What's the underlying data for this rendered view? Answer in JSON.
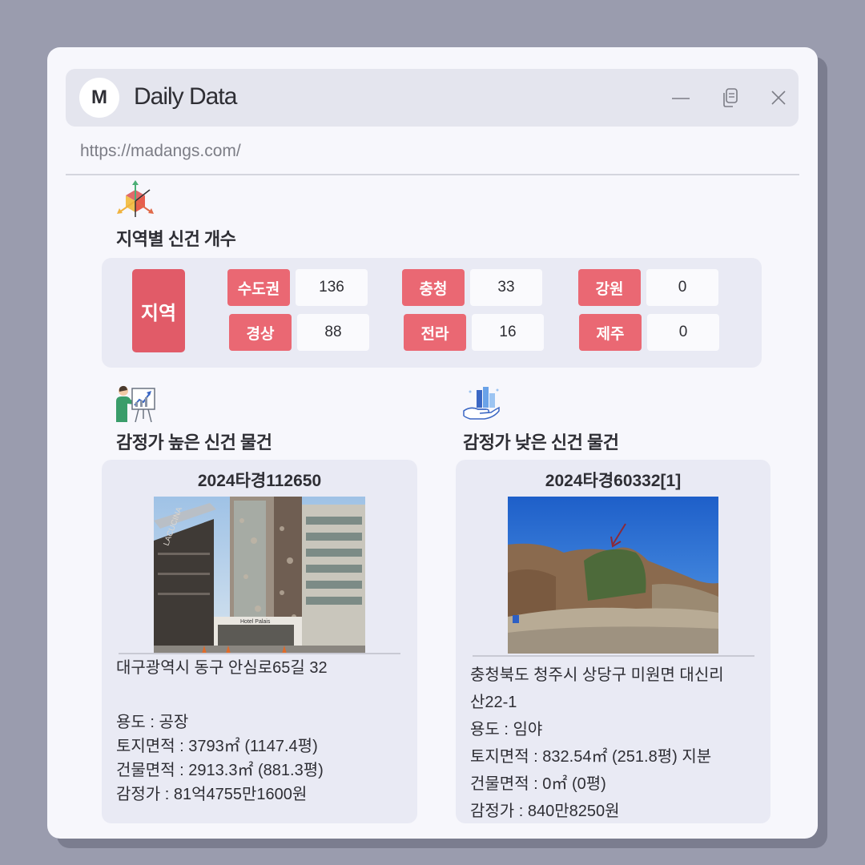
{
  "app": {
    "logo_letter": "M",
    "title": "Daily Data",
    "url": "https://madangs.com/"
  },
  "icons": {
    "minimize": "minimize-icon",
    "copy": "copy-icon",
    "close": "close-icon",
    "region_section": "3d-axis-cube-icon",
    "high_section": "presenter-chart-icon",
    "low_section": "hand-bar-chart-icon"
  },
  "regions": {
    "title": "지역별 신건 개수",
    "header": "지역",
    "items": [
      {
        "name": "수도권",
        "count": "136"
      },
      {
        "name": "충청",
        "count": "33"
      },
      {
        "name": "강원",
        "count": "0"
      },
      {
        "name": "경상",
        "count": "88"
      },
      {
        "name": "전라",
        "count": "16"
      },
      {
        "name": "제주",
        "count": "0"
      }
    ]
  },
  "high": {
    "title": "감정가 높은 신건 물건",
    "case_no": "2024타경112650",
    "address": "대구광역시 동구 안심로65길 32",
    "usage": "용도 : 공장",
    "land_area": "토지면적 : 3793㎡ (1147.4평)",
    "building_area": "건물면적 : 2913.3㎡ (881.3평)",
    "appraisal": "감정가 : 81억4755만1600원",
    "photo_sign": "LACUCINA",
    "photo_shop": "Hotel Palais"
  },
  "low": {
    "title": "감정가 낮은 신건 물건",
    "case_no": "2024타경60332[1]",
    "address_line1": "충청북도 청주시 상당구 미원면 대신리",
    "address_line2": "산22-1",
    "usage": "용도 : 임야",
    "land_area": "토지면적 : 832.54㎡ (251.8평) 지분",
    "building_area": "건물면적 : 0㎡ (0평)",
    "appraisal": "감정가 : 840만8250원"
  },
  "colors": {
    "accent_red": "#ea6873",
    "header_red": "#e15b68",
    "panel": "#e9eaf4",
    "background": "#9a9cae"
  }
}
